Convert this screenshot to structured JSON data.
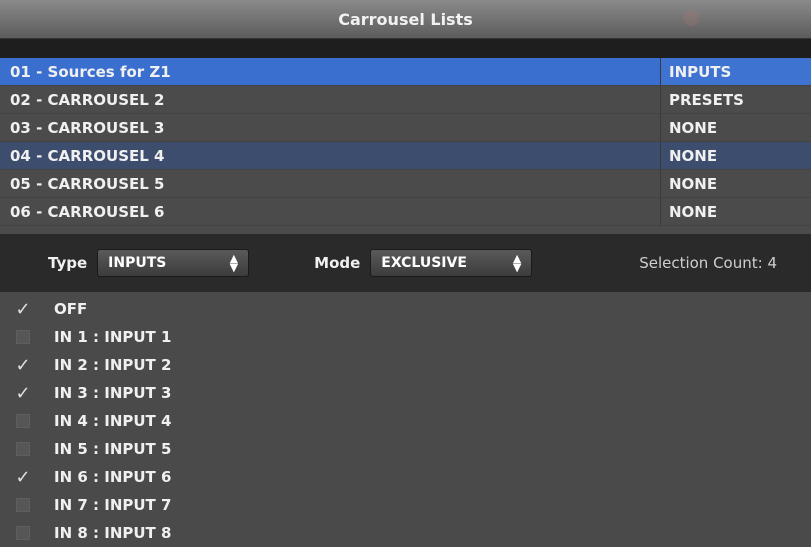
{
  "window": {
    "title": "Carrousel Lists"
  },
  "lists": [
    {
      "name": "01 - Sources for Z1",
      "type": "INPUTS",
      "state": "selected"
    },
    {
      "name": "02 - CARROUSEL 2",
      "type": "PRESETS",
      "state": "normal"
    },
    {
      "name": "03 - CARROUSEL 3",
      "type": "NONE",
      "state": "normal"
    },
    {
      "name": "04 - CARROUSEL 4",
      "type": "NONE",
      "state": "highlight"
    },
    {
      "name": "05 - CARROUSEL 5",
      "type": "NONE",
      "state": "normal"
    },
    {
      "name": "06 - CARROUSEL 6",
      "type": "NONE",
      "state": "normal"
    }
  ],
  "controls": {
    "type_label": "Type",
    "type_value": "INPUTS",
    "mode_label": "Mode",
    "mode_value": "EXCLUSIVE",
    "selection_count": "Selection Count: 4"
  },
  "items": [
    {
      "label": "OFF",
      "checked": true
    },
    {
      "label": "IN 1 : INPUT 1",
      "checked": false
    },
    {
      "label": "IN 2 : INPUT 2",
      "checked": true
    },
    {
      "label": "IN 3 : INPUT 3",
      "checked": true
    },
    {
      "label": "IN 4 : INPUT 4",
      "checked": false
    },
    {
      "label": "IN 5 : INPUT 5",
      "checked": false
    },
    {
      "label": "IN 6 : INPUT 6",
      "checked": true
    },
    {
      "label": "IN 7 : INPUT 7",
      "checked": false
    },
    {
      "label": "IN 8 : INPUT 8",
      "checked": false
    }
  ],
  "colors": {
    "selected_row": "#3a6fd0",
    "highlight_row": "#3d4d6e",
    "panel": "#4a4a4a",
    "controls_bar": "#2a2a2a"
  },
  "icons": {
    "checkmark": "checkmark-icon",
    "select_arrows": "updown-arrows-icon"
  }
}
